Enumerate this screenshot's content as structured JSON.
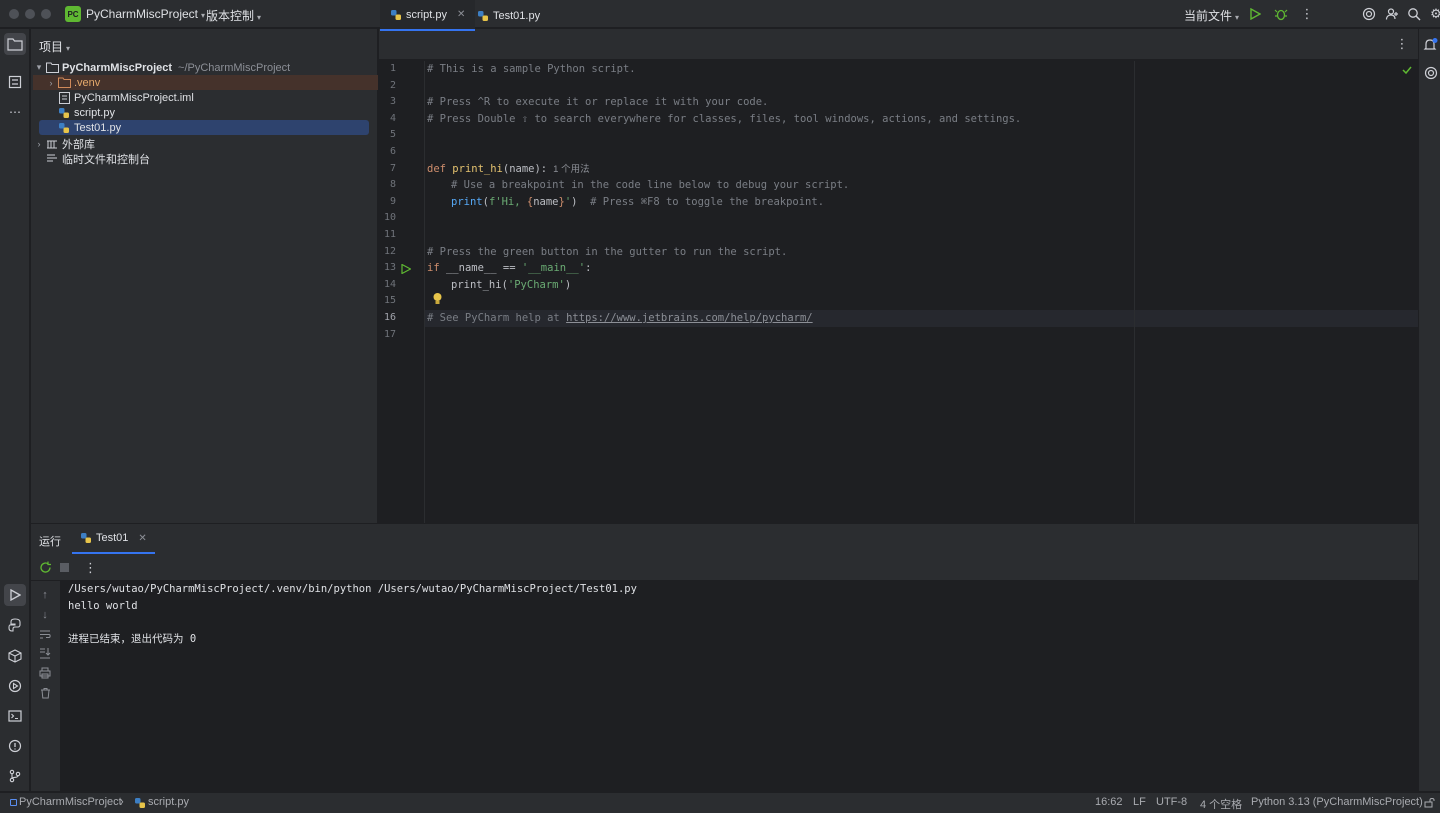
{
  "titlebar": {
    "project_badge": "PC",
    "project_name": "PyCharmMiscProject",
    "vcs_label": "版本控制",
    "run_config": "当前文件"
  },
  "project_panel": {
    "title": "项目",
    "root_name": "PyCharmMiscProject",
    "root_path": "~/PyCharmMiscProject",
    "items": [
      {
        "label": ".venv"
      },
      {
        "label": "PyCharmMiscProject.iml"
      },
      {
        "label": "script.py"
      },
      {
        "label": "Test01.py"
      }
    ],
    "external_libs": "外部库",
    "scratches": "临时文件和控制台"
  },
  "editor": {
    "tabs": [
      {
        "label": "script.py"
      },
      {
        "label": "Test01.py"
      }
    ],
    "line_numbers": [
      "1",
      "2",
      "3",
      "4",
      "5",
      "6",
      "7",
      "8",
      "9",
      "10",
      "11",
      "12",
      "13",
      "14",
      "15",
      "16",
      "17"
    ],
    "lines": {
      "l1": "# This is a sample Python script.",
      "l3": "# Press ^R to execute it or replace it with your code.",
      "l4": "# Press Double ⇧ to search everywhere for classes, files, tool windows, actions, and settings.",
      "l7_def": "def",
      "l7_name": "print_hi",
      "l7_args": "(name):",
      "l7_hint": "1 个用法",
      "l8": "# Use a breakpoint in the code line below to debug your script.",
      "l9_print": "print",
      "l9_open": "(",
      "l9_f": "f'Hi, ",
      "l9_brace_open": "{",
      "l9_var": "name",
      "l9_brace_close": "}",
      "l9_close_str": "'",
      "l9_paren": ")",
      "l9_comment": "  # Press ⌘F8 to toggle the breakpoint.",
      "l12": "# Press the green button in the gutter to run the script.",
      "l13_if": "if",
      "l13_mid": " __name__ == ",
      "l13_str": "'__main__'",
      "l13_end": ":",
      "l14_call": "print_hi(",
      "l14_str": "'PyCharm'",
      "l14_end": ")",
      "l16_comment": "# See PyCharm help at ",
      "l16_link": "https://www.jetbrains.com/help/pycharm/"
    }
  },
  "run_panel": {
    "title": "运行",
    "tab_label": "Test01",
    "console": [
      "/Users/wutao/PyCharmMiscProject/.venv/bin/python /Users/wutao/PyCharmMiscProject/Test01.py",
      "hello world",
      "",
      "进程已结束，退出代码为 0"
    ]
  },
  "statusbar": {
    "breadcrumb_project": "PyCharmMiscProject",
    "breadcrumb_file": "script.py",
    "position": "16:62",
    "line_sep": "LF",
    "encoding": "UTF-8",
    "indent": "4 个空格",
    "interpreter": "Python 3.13 (PyCharmMiscProject)"
  },
  "colors": {
    "accent": "#3574f0",
    "run_green": "#5fb832",
    "selection": "#2e436e"
  }
}
